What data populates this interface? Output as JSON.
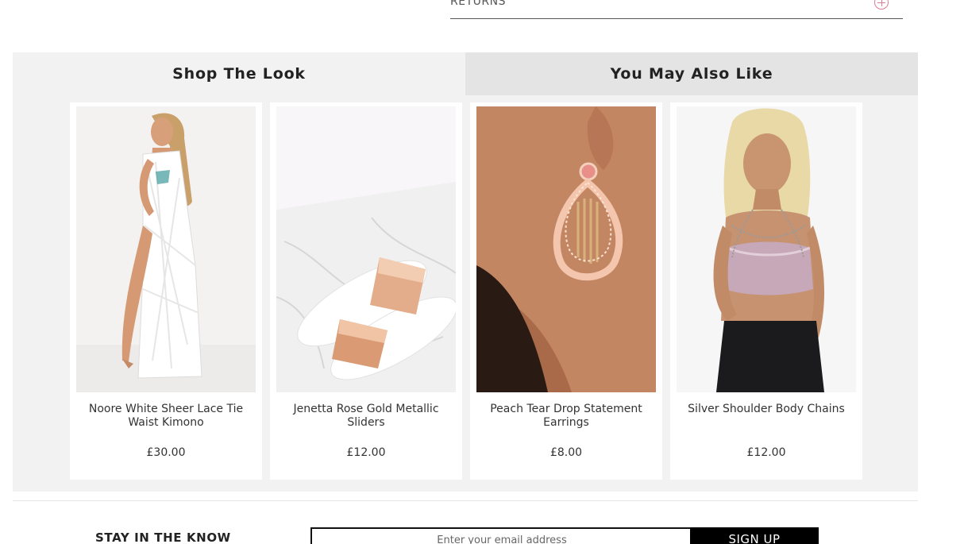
{
  "accordion": {
    "returns_label": "RETURNS"
  },
  "tabs": [
    {
      "label": "Shop The Look",
      "active": true
    },
    {
      "label": "You May Also Like",
      "active": false
    }
  ],
  "products": [
    {
      "name": "Noore White Sheer Lace Tie Waist Kimono",
      "price": "£30.00"
    },
    {
      "name": "Jenetta Rose Gold Metallic Sliders",
      "price": "£12.00"
    },
    {
      "name": "Peach Tear Drop Statement Earrings",
      "price": "£8.00"
    },
    {
      "name": "Silver Shoulder Body Chains",
      "price": "£12.00"
    }
  ],
  "newsletter": {
    "title": "STAY IN THE KNOW",
    "email_placeholder": "Enter your email address",
    "signup_label": "SIGN UP"
  },
  "colors": {
    "accent_pink": "#e07a93",
    "panel_bg": "#f2f2f2",
    "tab_inactive_bg": "#e4e4e4"
  }
}
